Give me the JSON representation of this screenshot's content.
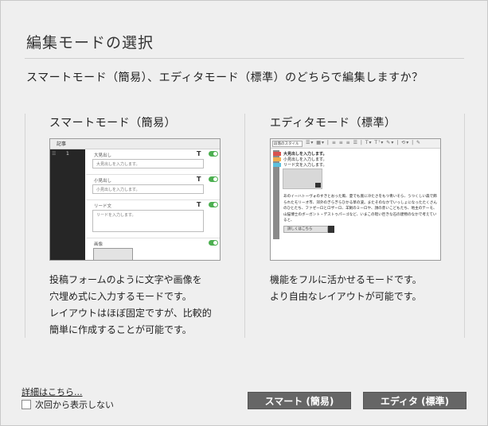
{
  "dialog": {
    "title": "編集モードの選択",
    "question": "スマートモード（簡易）、エディタモード（標準）のどちらで編集しますか？"
  },
  "smart": {
    "title": "スマートモード（簡易）",
    "thumb": {
      "top_label": "記事",
      "side_num": "1",
      "f1_label": "大見出し",
      "f1_placeholder": "大見出しを入力します。",
      "f2_label": "小見出し",
      "f2_placeholder": "小見出しを入力します。",
      "f3_label": "リード文",
      "f3_placeholder": "リードを入力します。",
      "f4_label": "画像",
      "t_glyph": "T"
    },
    "desc": [
      "投稿フォームのように文字や画像を",
      "穴埋め式に入力するモードです。",
      "レイアウトはほぼ固定ですが、比較的",
      "簡単に作成することが可能です。"
    ]
  },
  "editor": {
    "title": "エディタモード（標準）",
    "thumb": {
      "style_label": "段落のスタイル",
      "tools": "☰▾ ▦▾ | ≡ ≡ ≡ ☰ | T▾ Tᵀ▾ ✎▾ | ⟲▾ | ✎",
      "h1": "大見出しを入力します。",
      "h2": "小見出しを入力します。",
      "lead": "リード文を入力します。",
      "para": "あのイーハトーヴォのすきとおった風、夏でも底に冷たさをもつ青いそら、うつくしい森で飾られたモリーオ市、郊外のぎらぎらひかる草の波。またそのなかでいっしょになったたくさんのひとたち、ファゼーロとロザーロ、羊飼のミーロや、顔の赤いこどもたち、地主のテーモ、山猫博士のボーガント・デストゥパーゴなど、いまこの暗い巨きな石の建物のなかで考えていると、",
      "button": "詳しくはこちら",
      "colors": {
        "h1": "#d9534f",
        "h2": "#f0ad4e",
        "lead": "#5bc0de"
      }
    },
    "desc": [
      "機能をフルに活かせるモードです。",
      "より自由なレイアウトが可能です。"
    ]
  },
  "footer": {
    "details_link": "詳細はこちら...",
    "dont_show": "次回から表示しない",
    "smart_button": "スマート (簡易)",
    "editor_button": "エディタ (標準)"
  }
}
